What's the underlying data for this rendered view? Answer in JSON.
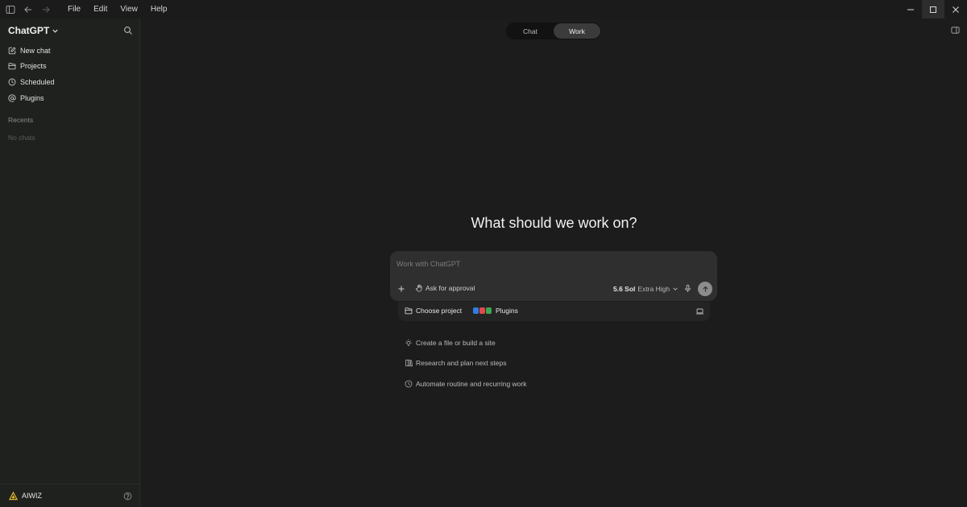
{
  "titlebar": {
    "menu": [
      "File",
      "Edit",
      "View",
      "Help"
    ]
  },
  "sidebar": {
    "brand": "ChatGPT",
    "items": [
      {
        "label": "New chat",
        "icon": "edit-icon"
      },
      {
        "label": "Projects",
        "icon": "folder-icon"
      },
      {
        "label": "Scheduled",
        "icon": "clock-icon"
      },
      {
        "label": "Plugins",
        "icon": "at-icon"
      }
    ],
    "recents_label": "Recents",
    "empty_label": "No chats",
    "footer": {
      "user": "AIWIZ"
    }
  },
  "main": {
    "tabs": [
      {
        "label": "Chat",
        "active": false
      },
      {
        "label": "Work",
        "active": true
      }
    ],
    "headline": "What should we work on?",
    "composer": {
      "placeholder": "Work with ChatGPT",
      "approval_label": "Ask for approval",
      "model_name": "5.6 Sol",
      "model_level": "Extra High"
    },
    "project_bar": {
      "choose_label": "Choose project",
      "plugins_label": "Plugins",
      "plugin_colors": [
        "#2f7de1",
        "#e5484d",
        "#3fa650"
      ]
    },
    "suggestions": [
      {
        "label": "Create a file or build a site",
        "icon": "lightbulb-icon"
      },
      {
        "label": "Research and plan next steps",
        "icon": "book-icon"
      },
      {
        "label": "Automate routine and recurring work",
        "icon": "clock-icon"
      }
    ]
  },
  "colors": {
    "background": "#1b1c1b",
    "sidebar": "#1f211f",
    "composer": "#2e2f2e",
    "brand_logo": "#e0b52f"
  }
}
